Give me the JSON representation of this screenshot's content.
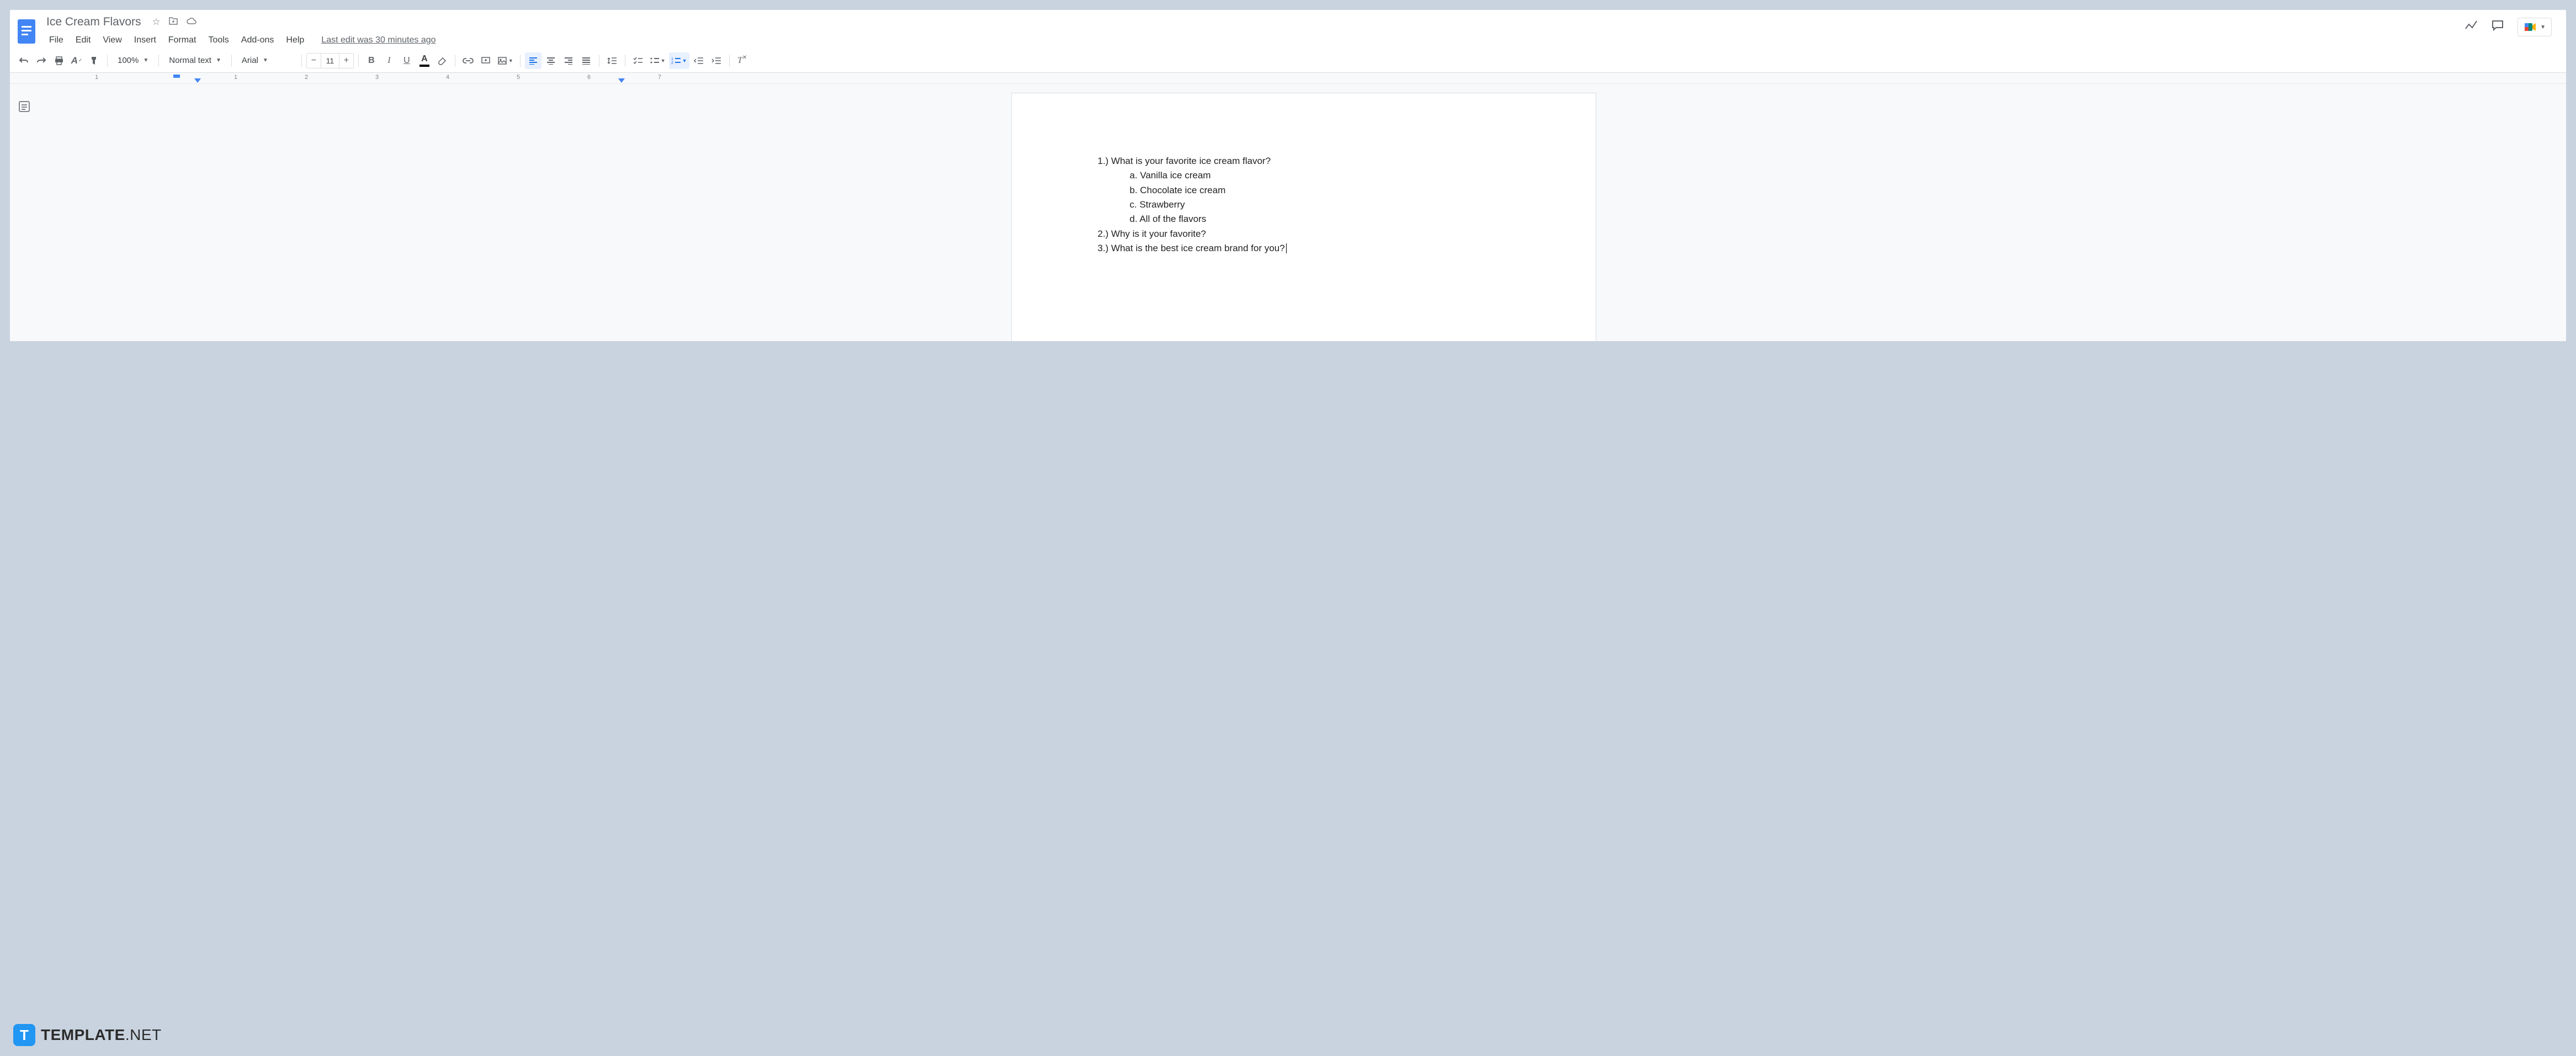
{
  "header": {
    "doc_title": "Ice Cream Flavors",
    "last_edit": "Last edit was 30 minutes ago"
  },
  "menu": {
    "file": "File",
    "edit": "Edit",
    "view": "View",
    "insert": "Insert",
    "format": "Format",
    "tools": "Tools",
    "addons": "Add-ons",
    "help": "Help"
  },
  "toolbar": {
    "zoom": "100%",
    "style": "Normal text",
    "font": "Arial",
    "font_size": "11"
  },
  "ruler": {
    "numbers": [
      "1",
      "1",
      "2",
      "3",
      "4",
      "5",
      "6",
      "7"
    ]
  },
  "document": {
    "q1": "1.)  What is your favorite ice cream flavor?",
    "q1a": "a.   Vanilla ice cream",
    "q1b": "b.   Chocolate ice cream",
    "q1c": "c.   Strawberry",
    "q1d": "d.   All of the flavors",
    "q2": "2.)  Why is it your favorite?",
    "q3": "3.)  What is the best ice cream brand for you?"
  },
  "watermark": {
    "logo_letter": "T",
    "bold": "TEMPLATE",
    "rest": ".NET"
  }
}
